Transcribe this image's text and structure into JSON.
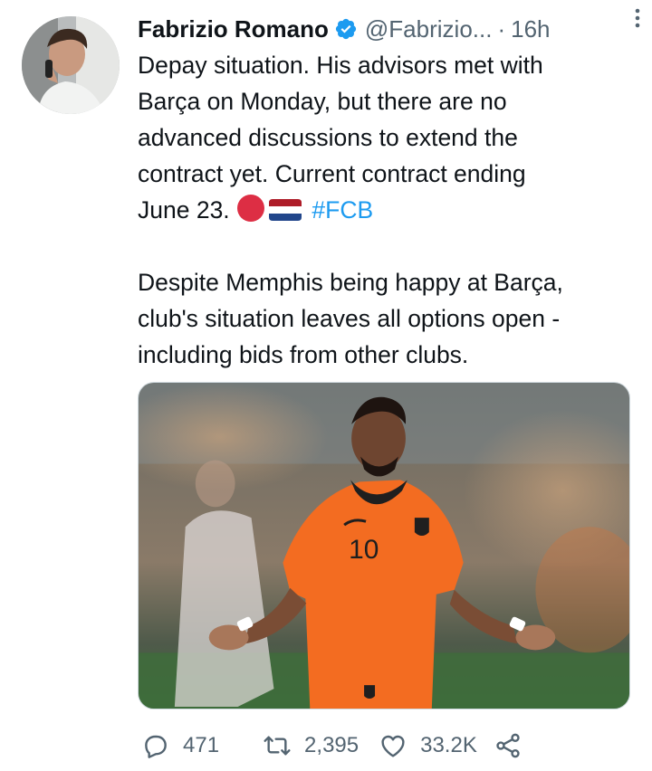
{
  "author": {
    "display_name": "Fabrizio Romano",
    "handle": "@Fabrizio...",
    "separator": "·",
    "time": "16h",
    "verified": true
  },
  "tweet": {
    "line1": "Depay situation. His advisors met with",
    "line2": "Barça on Monday, but there are no",
    "line3": "advanced discussions to extend the",
    "line4": "contract yet. Current contract ending",
    "line5": "June 23.",
    "hashtag": "#FCB",
    "line7": "Despite Memphis being happy at Barça,",
    "line8": "club's situation leaves all options open -",
    "line9": "including bids from other clubs.",
    "emojis": [
      "red-circle",
      "netherlands-flag"
    ]
  },
  "media": {
    "jersey_number": "10",
    "description_icon": "photo"
  },
  "stats": {
    "replies": "471",
    "retweets": "2,395",
    "likes": "33.2K"
  },
  "colors": {
    "accent": "#1d9bf0",
    "muted": "#536471",
    "text": "#0f1419",
    "orange_kit": "#f36c21"
  },
  "icons": {
    "reply": "reply-icon",
    "retweet": "retweet-icon",
    "like": "heart-icon",
    "share": "share-icon",
    "more": "more-icon",
    "verified": "verified-badge-icon"
  }
}
